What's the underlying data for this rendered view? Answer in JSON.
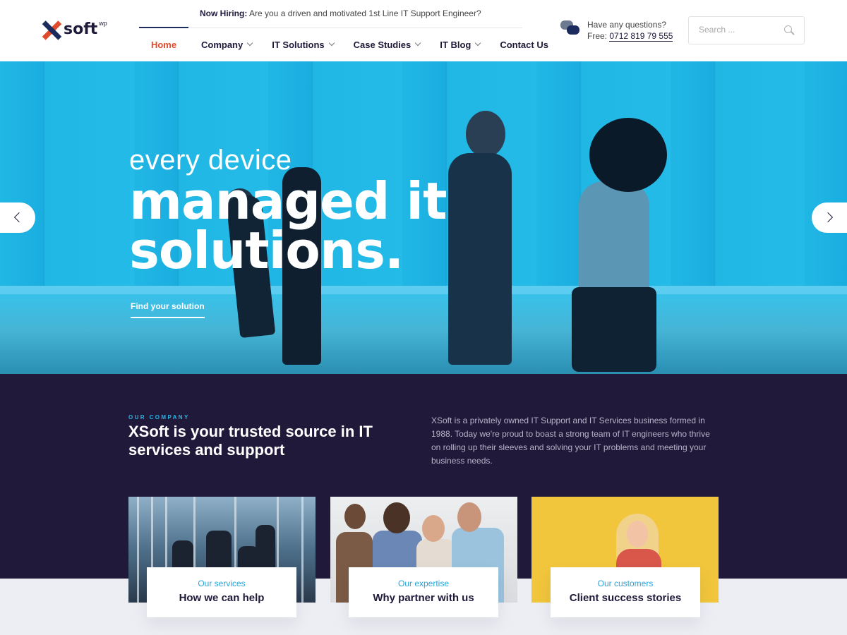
{
  "header": {
    "logo": {
      "text": "soft",
      "sup": "wp"
    },
    "topbar": {
      "label": "Now Hiring:",
      "text": "Are you a driven and motivated 1st Line IT Support Engineer?"
    },
    "nav": [
      {
        "label": "Home",
        "dropdown": false,
        "active": true
      },
      {
        "label": "Company",
        "dropdown": true
      },
      {
        "label": "IT Solutions",
        "dropdown": true
      },
      {
        "label": "Case Studies",
        "dropdown": true
      },
      {
        "label": "IT Blog",
        "dropdown": true
      },
      {
        "label": "Contact Us",
        "dropdown": false
      }
    ],
    "contact": {
      "question": "Have any questions?",
      "free_label": "Free:",
      "phone": "0712 819 79 555"
    },
    "search": {
      "placeholder": "Search ..."
    }
  },
  "hero": {
    "small": "every device",
    "big_line1": "managed it",
    "big_line2": "solutions.",
    "cta": "Find your solution"
  },
  "company": {
    "eyebrow": "OUR COMPANY",
    "title": "XSoft is your trusted source in IT services and support",
    "description": "XSoft is a privately owned IT Support and IT Services business formed in 1988. Today we're proud to boast a strong team of IT engineers who thrive on rolling up their sleeves and solving your IT problems and meeting your business needs."
  },
  "cards": [
    {
      "sub": "Our services",
      "main": "How we can help"
    },
    {
      "sub": "Our expertise",
      "main": "Why partner with us"
    },
    {
      "sub": "Our customers",
      "main": "Client success stories"
    }
  ],
  "colors": {
    "accent_red": "#e04b2b",
    "navy": "#1c2b5e",
    "hero_blue": "#1fb0dd",
    "dark_section": "#21193a",
    "link_blue": "#27a4d8"
  },
  "icons": [
    "logo-x-icon",
    "chat-bubbles-icon",
    "search-icon",
    "chevron-down-icon",
    "chevron-left-icon",
    "chevron-right-icon"
  ]
}
